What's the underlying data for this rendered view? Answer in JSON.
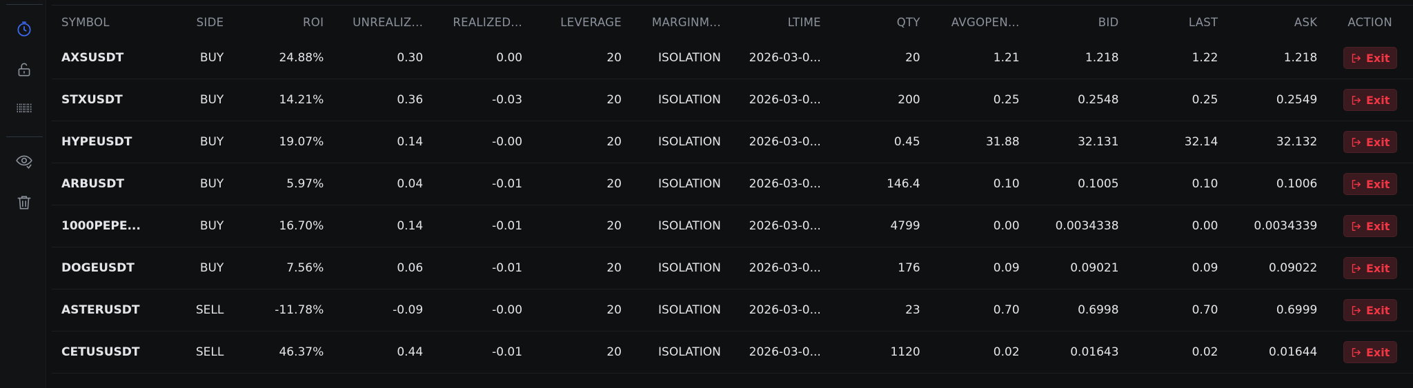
{
  "table": {
    "headers": {
      "symbol": "SYMBOL",
      "side": "SIDE",
      "roi": "ROI",
      "unrealized": "UNREALIZ...",
      "realized": "REALIZED...",
      "leverage": "LEVERAGE",
      "margin": "MARGINM...",
      "ltime": "LTIME",
      "qty": "QTY",
      "avgopen": "AVGOPEN...",
      "bid": "BID",
      "last": "LAST",
      "ask": "ASK",
      "action": "ACTION"
    },
    "exit_label": "Exit",
    "rows": [
      {
        "symbol": "AXSUSDT",
        "side": "BUY",
        "roi": "24.88%",
        "unrealized": "0.30",
        "realized": "0.00",
        "leverage": "20",
        "margin": "ISOLATION",
        "ltime": "2026-03-0...",
        "qty": "20",
        "avgopen": "1.21",
        "bid": "1.218",
        "last": "1.22",
        "ask": "1.218"
      },
      {
        "symbol": "STXUSDT",
        "side": "BUY",
        "roi": "14.21%",
        "unrealized": "0.36",
        "realized": "-0.03",
        "leverage": "20",
        "margin": "ISOLATION",
        "ltime": "2026-03-0...",
        "qty": "200",
        "avgopen": "0.25",
        "bid": "0.2548",
        "last": "0.25",
        "ask": "0.2549"
      },
      {
        "symbol": "HYPEUSDT",
        "side": "BUY",
        "roi": "19.07%",
        "unrealized": "0.14",
        "realized": "-0.00",
        "leverage": "20",
        "margin": "ISOLATION",
        "ltime": "2026-03-0...",
        "qty": "0.45",
        "avgopen": "31.88",
        "bid": "32.131",
        "last": "32.14",
        "ask": "32.132"
      },
      {
        "symbol": "ARBUSDT",
        "side": "BUY",
        "roi": "5.97%",
        "unrealized": "0.04",
        "realized": "-0.01",
        "leverage": "20",
        "margin": "ISOLATION",
        "ltime": "2026-03-0...",
        "qty": "146.4",
        "avgopen": "0.10",
        "bid": "0.1005",
        "last": "0.10",
        "ask": "0.1006"
      },
      {
        "symbol": "1000PEPE...",
        "side": "BUY",
        "roi": "16.70%",
        "unrealized": "0.14",
        "realized": "-0.01",
        "leverage": "20",
        "margin": "ISOLATION",
        "ltime": "2026-03-0...",
        "qty": "4799",
        "avgopen": "0.00",
        "bid": "0.0034338",
        "last": "0.00",
        "ask": "0.0034339"
      },
      {
        "symbol": "DOGEUSDT",
        "side": "BUY",
        "roi": "7.56%",
        "unrealized": "0.06",
        "realized": "-0.01",
        "leverage": "20",
        "margin": "ISOLATION",
        "ltime": "2026-03-0...",
        "qty": "176",
        "avgopen": "0.09",
        "bid": "0.09021",
        "last": "0.09",
        "ask": "0.09022"
      },
      {
        "symbol": "ASTERUSDT",
        "side": "SELL",
        "roi": "-11.78%",
        "unrealized": "-0.09",
        "realized": "-0.00",
        "leverage": "20",
        "margin": "ISOLATION",
        "ltime": "2026-03-0...",
        "qty": "23",
        "avgopen": "0.70",
        "bid": "0.6998",
        "last": "0.70",
        "ask": "0.6999"
      },
      {
        "symbol": "CETUSUSDT",
        "side": "SELL",
        "roi": "46.37%",
        "unrealized": "0.44",
        "realized": "-0.01",
        "leverage": "20",
        "margin": "ISOLATION",
        "ltime": "2026-03-0...",
        "qty": "1120",
        "avgopen": "0.02",
        "bid": "0.01643",
        "last": "0.02",
        "ask": "0.01644"
      }
    ]
  },
  "sidebar": {
    "icons": [
      "clock-icon",
      "unlock-icon",
      "barcode-icon",
      "eye-icon",
      "trash-icon"
    ]
  },
  "colors": {
    "positive": "#26a17b",
    "negative": "#f23645",
    "accent": "#3d6bf5",
    "background": "#0f1012"
  }
}
